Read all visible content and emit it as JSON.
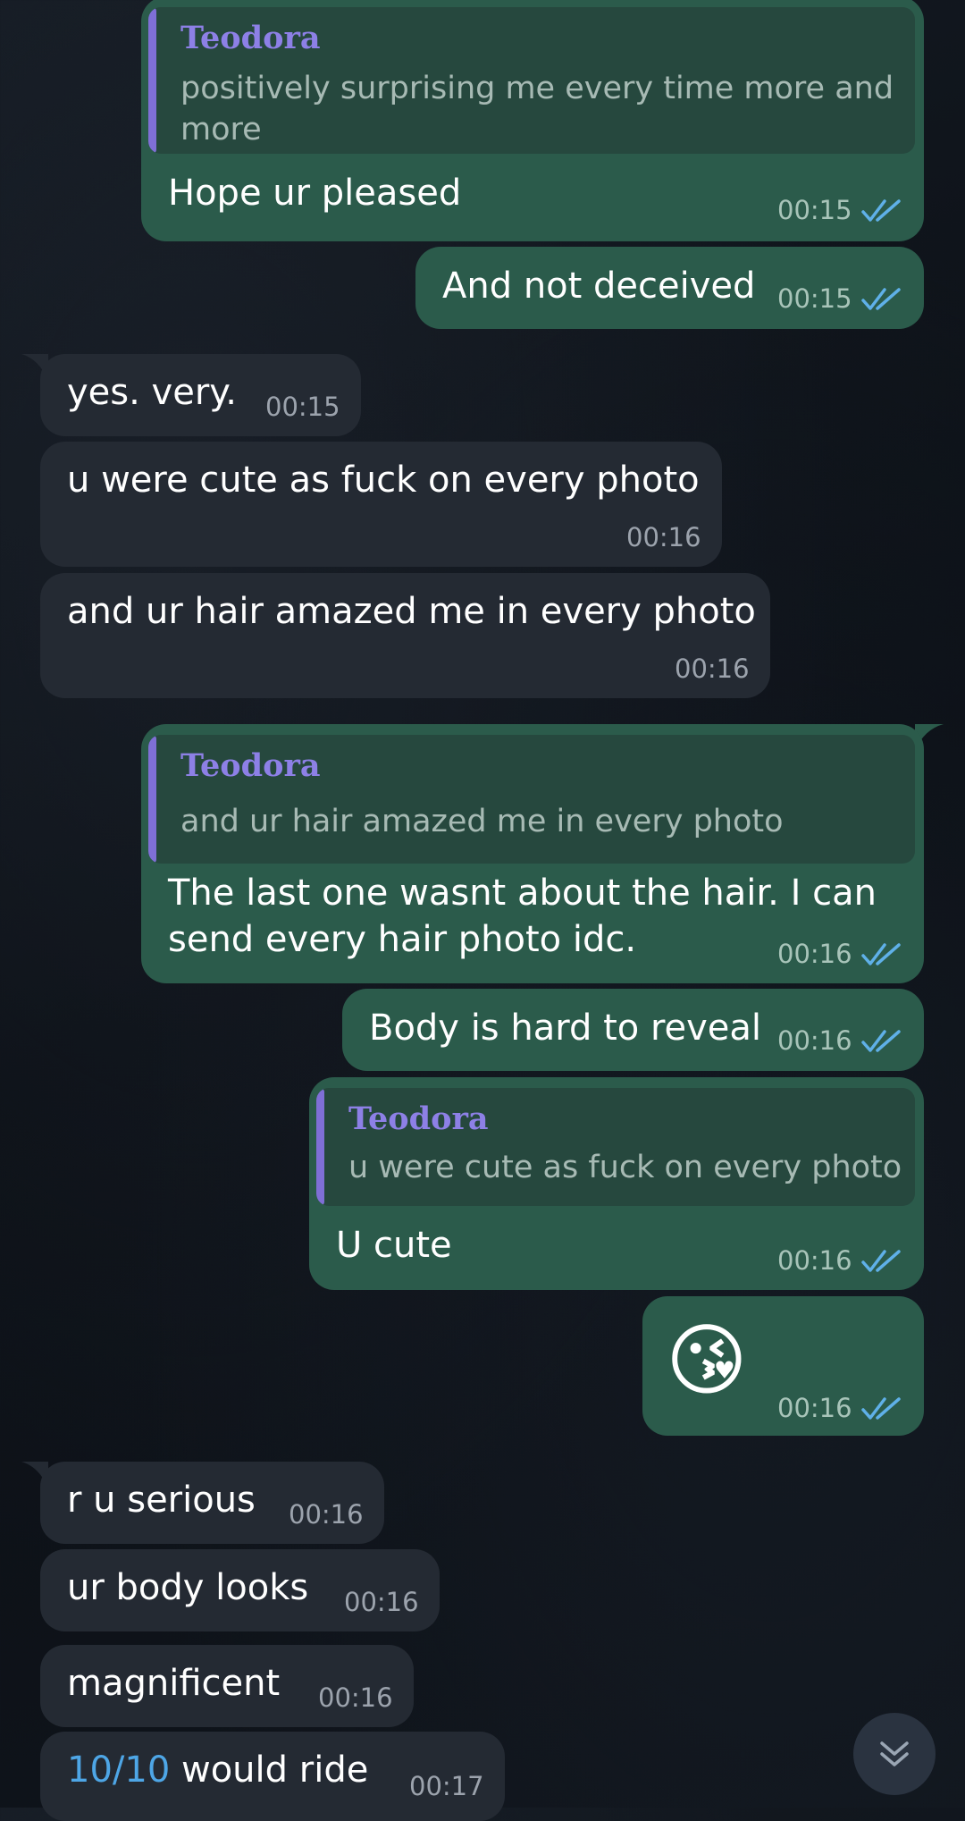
{
  "messages": [
    {
      "quote_name": "Teodora",
      "quote_text": "positively surprising me every time more and\nmore",
      "text": "Hope ur pleased",
      "time": "00:15"
    },
    {
      "text": "And not deceived",
      "time": "00:15"
    },
    {
      "text": "yes. very.",
      "time": "00:15"
    },
    {
      "text": "u were cute as fuck on every photo",
      "time": "00:16"
    },
    {
      "text": "and ur hair amazed me in every photo",
      "time": "00:16"
    },
    {
      "quote_name": "Teodora",
      "quote_text": "and ur hair amazed me in every photo",
      "text": "The last one wasnt about the hair. I can\nsend every hair photo idc.",
      "time": "00:16"
    },
    {
      "text": "Body is hard to reveal",
      "time": "00:16"
    },
    {
      "quote_name": "Teodora",
      "quote_text": "u were cute as fuck on every photo",
      "text": "U cute",
      "time": "00:16"
    },
    {
      "emoji": "😘",
      "time": "00:16"
    },
    {
      "text": "r u serious",
      "time": "00:16"
    },
    {
      "text": "ur body looks",
      "time": "00:16"
    },
    {
      "text": "magnificent",
      "time": "00:16"
    },
    {
      "link": "10/10",
      "text": " would ride",
      "time": "00:17"
    }
  ],
  "icons": {
    "read": "double-check-icon",
    "scroll": "chevron-down-icon"
  },
  "colors": {
    "outgoing": "#2b5b4b",
    "incoming": "#242a33",
    "quote_name": "#8d80e6",
    "checks": "#5fb0e8"
  }
}
